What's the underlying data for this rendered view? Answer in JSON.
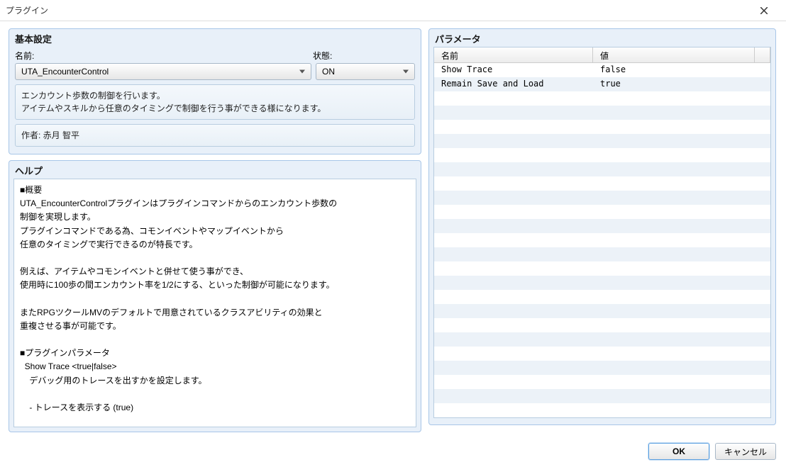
{
  "window": {
    "title": "プラグイン"
  },
  "basic": {
    "group_title": "基本設定",
    "name_label": "名前:",
    "status_label": "状態:",
    "name_value": "UTA_EncounterControl",
    "status_value": "ON",
    "description": "エンカウント歩数の制御を行います。\nアイテムやスキルから任意のタイミングで制御を行う事ができる様になります。",
    "author": "作者: 赤月 智平"
  },
  "help": {
    "group_title": "ヘルプ",
    "text": "■概要\nUTA_EncounterControlプラグインはプラグインコマンドからのエンカウント歩数の\n制御を実現します。\nプラグインコマンドである為、コモンイベントやマップイベントから\n任意のタイミングで実行できるのが特長です。\n\n例えば、アイテムやコモンイベントと併せて使う事ができ、\n使用時に100歩の間エンカウント率を1/2にする、といった制御が可能になります。\n\nまたRPGツクールMVのデフォルトで用意されているクラスアビリティの効果と\n重複させる事が可能です。\n\n■プラグインパラメータ\n  Show Trace <true|false>\n    デバッグ用のトレースを出すかを設定します。\n\n    - トレースを表示する (true)"
  },
  "params": {
    "group_title": "パラメータ",
    "header_name": "名前",
    "header_value": "値",
    "rows": [
      {
        "name": "Show Trace",
        "value": "false"
      },
      {
        "name": "Remain Save and Load",
        "value": "true"
      }
    ]
  },
  "buttons": {
    "ok": "OK",
    "cancel": "キャンセル"
  }
}
